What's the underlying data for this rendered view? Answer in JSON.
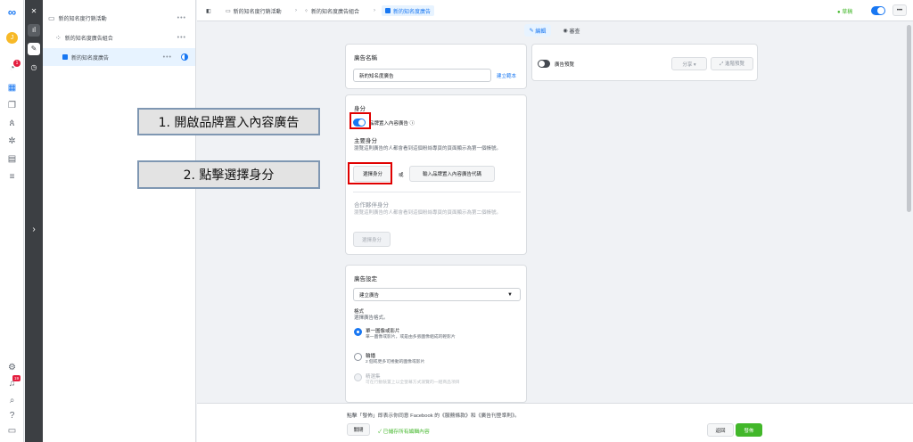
{
  "rail": {
    "logo": "∞",
    "avatar": "J",
    "notif_badge": "1",
    "bottom_badge": "19"
  },
  "tree": {
    "campaign": "新的知名度行銷活動",
    "adset": "新的知名度廣告組合",
    "ad": "新的知名度廣告",
    "more": "•••"
  },
  "topbar": {
    "crumb_campaign": "新的知名度行銷活動",
    "crumb_adset": "新的知名度廣告組合",
    "crumb_ad": "新的知名度廣告",
    "status": "● 草稿",
    "edit_tab": "編輯",
    "review_tab": "審查",
    "more": "•••"
  },
  "ad_name": {
    "title": "廣告名稱",
    "value": "新的知名度廣告",
    "template_link": "建立範本"
  },
  "identity": {
    "title": "身分",
    "branded_toggle_label": "品牌置入內容廣告",
    "primary_title": "主要身分",
    "primary_desc": "瀏覽這則廣告的人都會看到這個粉絲專頁的頁面顯示為第一個帳號。",
    "choose_button": "選擇身分",
    "or": "或",
    "code_button": "輸入品牌置入內容廣告代碼",
    "partner_title": "合作夥伴身分",
    "partner_desc": "瀏覽這則廣告的人都會看到這個粉絲專頁的頁面顯示為第二個帳號。",
    "partner_button": "選擇身分"
  },
  "callouts": {
    "step1": "1. 開啟品牌置入內容廣告",
    "step2": "2. 點擊選擇身分"
  },
  "ad_setup": {
    "title": "廣告設定",
    "dropdown_value": "建立廣告",
    "format_title": "格式",
    "format_desc": "選擇廣告格式。",
    "options": [
      {
        "label": "單一圖像或影片",
        "desc": "單一圖像或影片，或是由多張圖像組成的輕影片"
      },
      {
        "label": "輪播",
        "desc": "2 個或更多可捲動的圖像或影片"
      },
      {
        "label": "精選集",
        "desc": "可在行動裝置上以全螢幕方式瀏覽的一組商品項目"
      }
    ]
  },
  "preview": {
    "toggle_label": "廣告預覽",
    "share_button": "分享 ▾",
    "expand_button": "⤢ 進階預覽"
  },
  "bottom": {
    "terms": "點擊「發佈」即表示你同意 Facebook 的《服務條款》和《廣告刊登準則》。",
    "close_button": "關閉",
    "saved_status": "✓ 已儲存所有編輯內容",
    "back_button": "返回",
    "publish_button": "發佈"
  },
  "colors": {
    "accent": "#1877f2",
    "publish": "#42b72a",
    "callout_red": "#e00000"
  }
}
